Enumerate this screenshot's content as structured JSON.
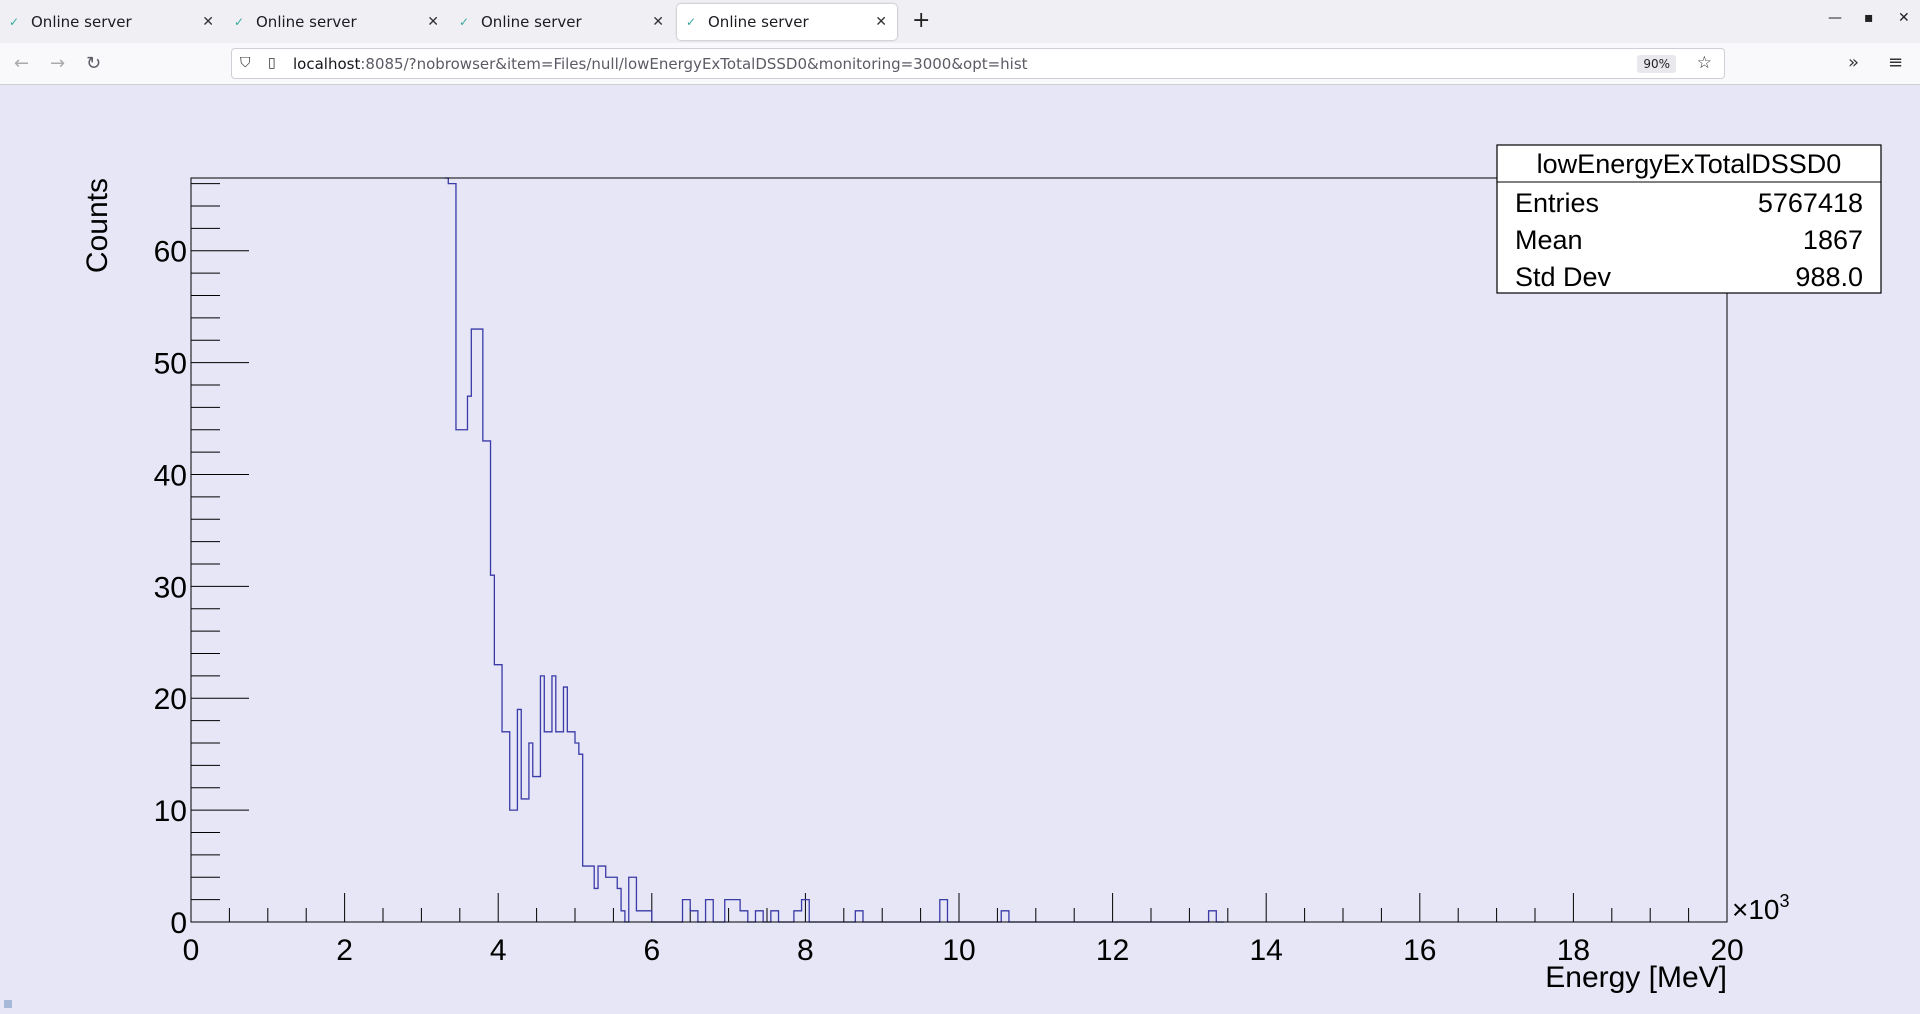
{
  "tabs": [
    {
      "label": "Online server",
      "active": false
    },
    {
      "label": "Online server",
      "active": false
    },
    {
      "label": "Online server",
      "active": false
    },
    {
      "label": "Online server",
      "active": true
    }
  ],
  "address": {
    "host": "localhost",
    "rest": ":8085/?nobrowser&item=Files/null/lowEnergyExTotalDSSD0&monitoring=3000&opt=hist",
    "zoom": "90%"
  },
  "icons": {
    "back": "arrow-left-icon",
    "forward": "arrow-right-icon",
    "reload": "reload-icon",
    "shield": "shield-icon",
    "page": "page-icon",
    "bookmark": "star-icon",
    "overflow": "chevron-double-right-icon",
    "menu": "hamburger-menu-icon",
    "newtab": "plus-icon",
    "favicon": "root-leaf-icon"
  },
  "stats": {
    "title": "lowEnergyExTotalDSSD0",
    "rows": [
      {
        "label": "Entries",
        "value": "5767418"
      },
      {
        "label": "Mean",
        "value": "1867"
      },
      {
        "label": "Std Dev",
        "value": "988.0"
      }
    ]
  },
  "colors": {
    "frame": "#e6e6f6",
    "line": "#3a3aa8",
    "axis": "#000000"
  },
  "chart_data": {
    "type": "step-histogram",
    "xlabel": "Energy [MeV]",
    "ylabel": "Counts",
    "x_exponent": "×10",
    "x_exponent_power": "3",
    "xlim": [
      0,
      20000
    ],
    "ylim": [
      0,
      66.5
    ],
    "x_ticks": [
      "0",
      "2",
      "4",
      "6",
      "8",
      "10",
      "12",
      "14",
      "16",
      "18",
      "20"
    ],
    "y_ticks": [
      "0",
      "10",
      "20",
      "30",
      "40",
      "50",
      "60"
    ],
    "bin_width": 100,
    "bins": [
      {
        "x": 3300,
        "y": 66.5
      },
      {
        "x": 3350,
        "y": 66
      },
      {
        "x": 3450,
        "y": 44
      },
      {
        "x": 3600,
        "y": 47
      },
      {
        "x": 3650,
        "y": 53
      },
      {
        "x": 3800,
        "y": 43
      },
      {
        "x": 3900,
        "y": 31
      },
      {
        "x": 3950,
        "y": 23
      },
      {
        "x": 4050,
        "y": 17
      },
      {
        "x": 4150,
        "y": 10
      },
      {
        "x": 4250,
        "y": 19
      },
      {
        "x": 4300,
        "y": 11
      },
      {
        "x": 4400,
        "y": 16
      },
      {
        "x": 4450,
        "y": 13
      },
      {
        "x": 4550,
        "y": 22
      },
      {
        "x": 4600,
        "y": 17
      },
      {
        "x": 4700,
        "y": 22
      },
      {
        "x": 4750,
        "y": 17
      },
      {
        "x": 4850,
        "y": 21
      },
      {
        "x": 4900,
        "y": 17
      },
      {
        "x": 5000,
        "y": 16
      },
      {
        "x": 5050,
        "y": 15
      },
      {
        "x": 5100,
        "y": 5
      },
      {
        "x": 5250,
        "y": 3
      },
      {
        "x": 5300,
        "y": 5
      },
      {
        "x": 5400,
        "y": 4
      },
      {
        "x": 5550,
        "y": 3
      },
      {
        "x": 5600,
        "y": 1
      },
      {
        "x": 5650,
        "y": 0
      },
      {
        "x": 5700,
        "y": 4
      },
      {
        "x": 5800,
        "y": 1
      },
      {
        "x": 6000,
        "y": 0
      },
      {
        "x": 6400,
        "y": 2
      },
      {
        "x": 6500,
        "y": 1
      },
      {
        "x": 6600,
        "y": 0
      },
      {
        "x": 6700,
        "y": 2
      },
      {
        "x": 6800,
        "y": 0
      },
      {
        "x": 6950,
        "y": 2
      },
      {
        "x": 7150,
        "y": 1
      },
      {
        "x": 7250,
        "y": 0
      },
      {
        "x": 7350,
        "y": 1
      },
      {
        "x": 7450,
        "y": 0
      },
      {
        "x": 7550,
        "y": 1
      },
      {
        "x": 7650,
        "y": 0
      },
      {
        "x": 7850,
        "y": 1
      },
      {
        "x": 7950,
        "y": 2
      },
      {
        "x": 8050,
        "y": 0
      },
      {
        "x": 8650,
        "y": 1
      },
      {
        "x": 8750,
        "y": 0
      },
      {
        "x": 9750,
        "y": 2
      },
      {
        "x": 9850,
        "y": 0
      },
      {
        "x": 10550,
        "y": 1
      },
      {
        "x": 10650,
        "y": 0
      },
      {
        "x": 13250,
        "y": 1
      },
      {
        "x": 13350,
        "y": 0
      }
    ]
  }
}
